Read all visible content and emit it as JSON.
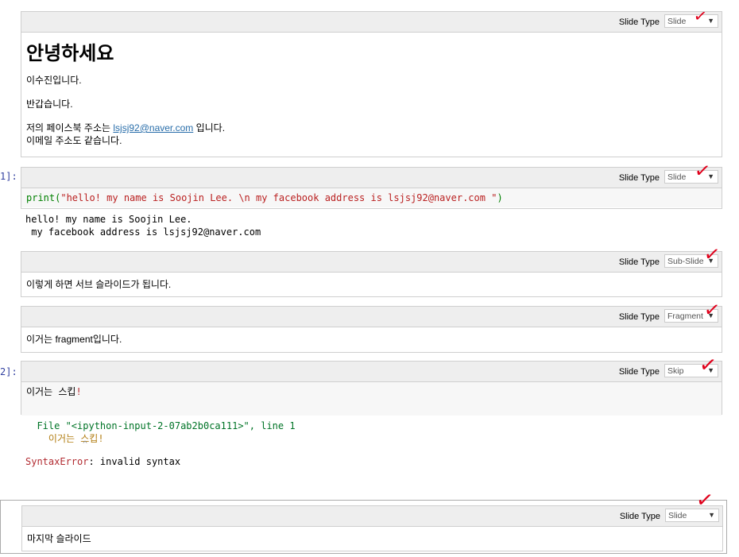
{
  "slide_type_label": "Slide Type",
  "cells": {
    "c1": {
      "slide_type": "Slide",
      "heading": "안녕하세요",
      "line1": "이수진입니다.",
      "line2": "반갑습니다.",
      "line3_pre": "저의 페이스북 주소는 ",
      "line3_link": "lsjsj92@naver.com",
      "line3_post": " 입니다.",
      "line4": "이메일 주소도 같습니다."
    },
    "c2": {
      "prompt": "1]:",
      "slide_type": "Slide",
      "code_func": "print(",
      "code_str": "\"hello! my name is Soojin Lee. \\n my facebook address is lsjsj92@naver.com \"",
      "code_close": ")",
      "output_line1": "hello! my name is Soojin Lee.",
      "output_line2": " my facebook address is lsjsj92@naver.com"
    },
    "c3": {
      "slide_type": "Sub-Slide",
      "text": "이렇게 하면 서브 슬라이드가 됩니다."
    },
    "c4": {
      "slide_type": "Fragment",
      "text_pre": "이거는 ",
      "text_en": "fragment",
      "text_post": "입니다."
    },
    "c5": {
      "prompt": "2]:",
      "slide_type": "Skip",
      "code_text": "이거는 스킵",
      "code_excl": "!",
      "err_file_pre": "File ",
      "err_file_name": "\"<ipython-input-2-07ab2b0ca111>\"",
      "err_line": ", line 1",
      "err_src": "이거는 스킵!",
      "err_caret": "^",
      "err_type": "SyntaxError",
      "err_msg": ": invalid syntax"
    },
    "c6": {
      "slide_type": "Slide",
      "text": "마지막 슬라이드"
    }
  },
  "colors": {
    "accent_check": "#e0001b",
    "link": "#296eaa",
    "prompt": "#303f9f"
  },
  "icons": [
    "checkmark-icon",
    "dropdown-arrow-icon"
  ]
}
